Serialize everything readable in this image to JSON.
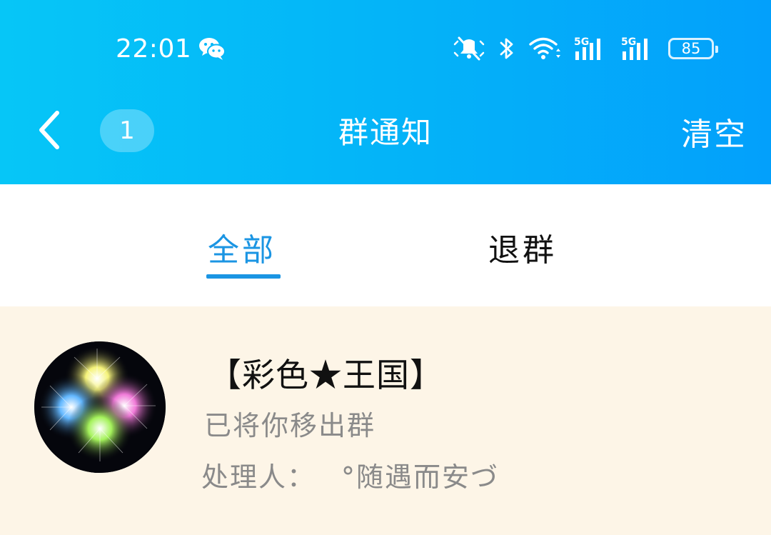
{
  "status_bar": {
    "time": "22:01",
    "battery": "85",
    "icons": [
      "wechat-icon",
      "mute-icon",
      "bluetooth-icon",
      "wifi-icon",
      "signal-5g-icon",
      "signal-5g-icon",
      "battery-icon"
    ]
  },
  "header": {
    "badge_count": "1",
    "title": "群通知",
    "clear_label": "清空",
    "back_icon": "chevron-left-icon"
  },
  "tabs": [
    {
      "label": "全部",
      "active": true
    },
    {
      "label": "退群",
      "active": false
    }
  ],
  "notices": [
    {
      "group_name": "【彩色★王国】",
      "message": "已将你移出群",
      "handler_label": "处理人：",
      "handler_name": "°随遇而安づ"
    }
  ],
  "colors": {
    "header_gradient_start": "#06c6f7",
    "header_gradient_end": "#03a0fb",
    "accent": "#1b95e3",
    "notice_bg": "#fdf5e7",
    "muted_text": "#8a8a8a"
  }
}
